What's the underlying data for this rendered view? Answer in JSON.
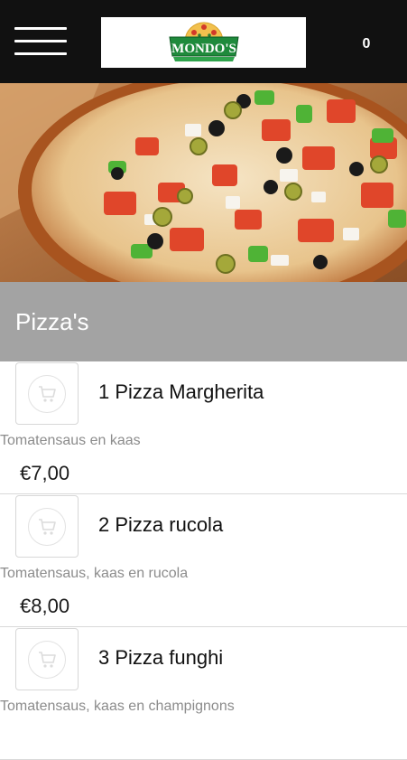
{
  "header": {
    "menu_icon": "hamburger-menu-icon",
    "logo_text": "MONDO'S",
    "cart_count": "0"
  },
  "hero": {
    "image_subject": "vegetable pizza with olives, tomatoes, feta and peppers"
  },
  "category": {
    "title": "Pizza's"
  },
  "products": [
    {
      "name": "1 Pizza Margherita",
      "description": "Tomatensaus en kaas",
      "price": "€7,00"
    },
    {
      "name": "2 Pizza rucola",
      "description": "Tomatensaus, kaas en rucola",
      "price": "€8,00"
    },
    {
      "name": "3 Pizza funghi",
      "description": "Tomatensaus, kaas en champignons",
      "price": ""
    }
  ],
  "icons": {
    "add_to_cart": "cart-icon"
  },
  "colors": {
    "header_bg": "#111111",
    "category_bg": "#a3a3a3",
    "logo_green": "#1f8a3c",
    "desc_text": "#8c8c8c"
  }
}
